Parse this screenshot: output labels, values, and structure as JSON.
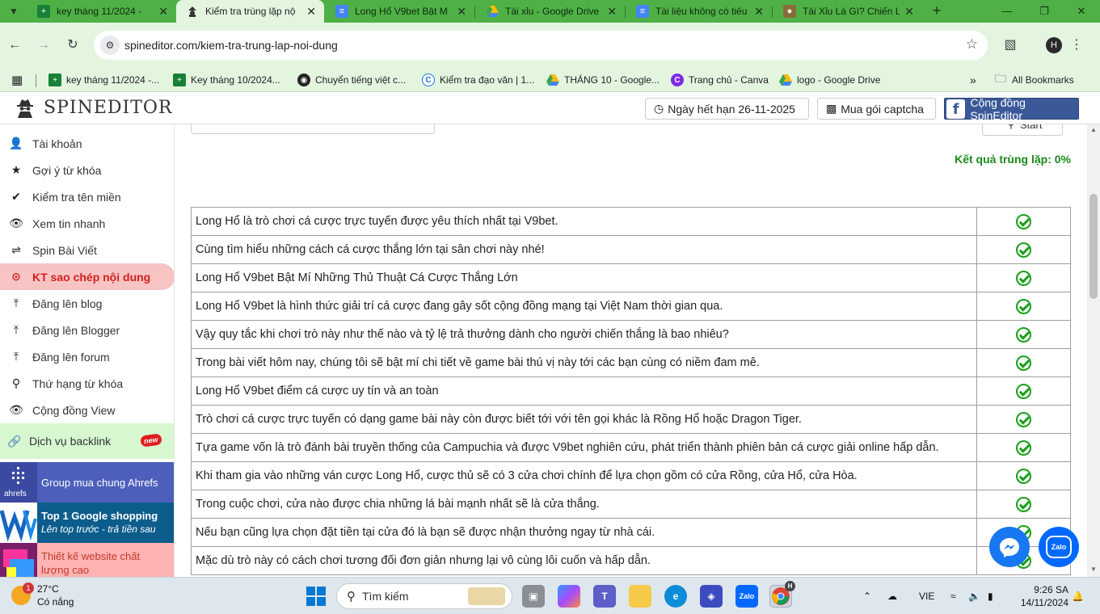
{
  "browser": {
    "tabs": [
      {
        "title": "key tháng 11/2024 - ",
        "icon": "sheets-icon",
        "active": false
      },
      {
        "title": "Kiểm tra trùng lặp nộ",
        "icon": "spineditor-icon",
        "active": true
      },
      {
        "title": "Long Hổ V9bet Bật M",
        "icon": "docs-icon",
        "active": false
      },
      {
        "title": "Tài xỉu - Google Drive",
        "icon": "drive-icon",
        "active": false
      },
      {
        "title": "Tài liệu không có tiêu",
        "icon": "docs-icon",
        "active": false
      },
      {
        "title": "Tài Xỉu Là Gì? Chiến L",
        "icon": "web-icon",
        "active": false
      }
    ],
    "url": "spineditor.com/kiem-tra-trung-lap-noi-dung",
    "profile_initial": "H",
    "bookmarks": [
      {
        "label": "key tháng 11/2024 -...",
        "icon": "sheets-icon"
      },
      {
        "label": "Key tháng 10/2024...",
        "icon": "sheets-icon"
      },
      {
        "label": "Chuyển tiếng việt c...",
        "icon": "globe-icon"
      },
      {
        "label": "Kiểm tra đạo văn | 1...",
        "icon": "c-icon"
      },
      {
        "label": "THÁNG 10 - Google...",
        "icon": "drive-icon"
      },
      {
        "label": "Trang chủ - Canva",
        "icon": "canva-icon"
      },
      {
        "label": "logo - Google Drive",
        "icon": "drive-icon"
      }
    ],
    "all_bookmarks": "All Bookmarks"
  },
  "header": {
    "logo_text": "SPINEDITOR",
    "expiry": "Ngày hết hạn 26-11-2025",
    "captcha": "Mua gói captcha",
    "community": "Cộng đồng SpinEditor"
  },
  "sidebar": {
    "items": [
      {
        "label": "Tài khoản",
        "icon": "user-icon"
      },
      {
        "label": "Gợi ý từ khóa",
        "icon": "star-icon"
      },
      {
        "label": "Kiểm tra tên miền",
        "icon": "check-icon"
      },
      {
        "label": "Xem tin nhanh",
        "icon": "eye-icon"
      },
      {
        "label": "Spin Bài Viết",
        "icon": "shuffle-icon"
      },
      {
        "label": "KT sao chép nội dung",
        "icon": "copy-check-icon",
        "active": true
      },
      {
        "label": "Đăng lên blog",
        "icon": "upload-icon"
      },
      {
        "label": "Đăng lên Blogger",
        "icon": "upload-icon"
      },
      {
        "label": "Đăng lên forum",
        "icon": "upload-icon"
      },
      {
        "label": "Thứ hạng từ khóa",
        "icon": "search-icon"
      },
      {
        "label": "Cộng đồng View",
        "icon": "eye-icon"
      }
    ],
    "backlink": {
      "label": "Dịch vụ backlink",
      "badge": "new"
    },
    "promos": [
      {
        "line1": "Group mua chung Ahrefs",
        "line2": "",
        "brand": "ahrefs"
      },
      {
        "line1": "Top 1 Google shopping",
        "line2": "Lên top trước - trả tiền sau",
        "brand": ""
      },
      {
        "line1": "Thiết kế website chất",
        "line2": "lượng cao",
        "brand": ""
      }
    ]
  },
  "main": {
    "start_label": "Start",
    "result_label": "Kết quả trùng lặp: 0%",
    "rows": [
      "Long Hổ là trò chơi cá cược trực tuyến được yêu thích nhất tại V9bet.",
      "Cùng tìm hiểu những cách cá cược thắng lớn tại sân chơi này nhé!",
      "Long Hổ V9bet Bật Mí Những Thủ Thuật Cá Cược Thắng Lớn",
      "Long Hổ V9bet là hình thức giải trí cá cược đang gây sốt cộng đồng mạng tại Việt Nam thời gian qua.",
      "Vậy quy tắc khi chơi trò này như thế nào và tỷ lệ trả thưởng dành cho người chiến thắng là bao nhiêu?",
      "Trong bài viết hôm nay, chúng tôi sẽ bật mí chi tiết về game bài thú vị này tới các bạn cùng có niềm đam mê.",
      "Long Hổ V9bet điểm cá cược uy tín và an toàn",
      "Trò chơi cá cược trực tuyến có dạng game bài này còn được biết tới với tên gọi khác là Rồng Hổ hoặc Dragon Tiger.",
      "Tựa game vốn là trò đánh bài truyền thống của Campuchia và được V9bet nghiên cứu, phát triển thành phiên bản cá cược giải online hấp dẫn.",
      "Khi tham gia vào những ván cược Long Hổ, cược thủ sẽ có 3 cửa chơi chính để lựa chọn gồm có cửa Rồng, cửa Hổ, cửa Hòa.",
      "Trong cuộc chơi, cửa nào được chia những lá bài mạnh nhất sẽ là cửa thắng.",
      "Nếu bạn cũng lựa chọn đặt tiền tại cửa đó là bạn sẽ được nhận thưởng ngay từ nhà cái.",
      "Mặc dù trò này có cách chơi tương đối đơn giản nhưng lại vô cùng lôi cuốn và hấp dẫn."
    ],
    "zalo_label": "Zalo"
  },
  "taskbar": {
    "temperature": "27°C",
    "weather": "Có nắng",
    "weather_badge": "1",
    "search_placeholder": "Tìm kiếm",
    "zalo_app": "Zalo",
    "chrome_badge": "H",
    "language": "VIE",
    "time": "9:26 SA",
    "date": "14/11/2024"
  },
  "colors": {
    "tab_strip": "#4fb047",
    "toolbar": "#e3f5df",
    "active_menu_bg": "#f8c3c3",
    "active_menu_text": "#d01f1f",
    "result_green": "#1b8a1b",
    "facebook_blue": "#3b5998"
  }
}
